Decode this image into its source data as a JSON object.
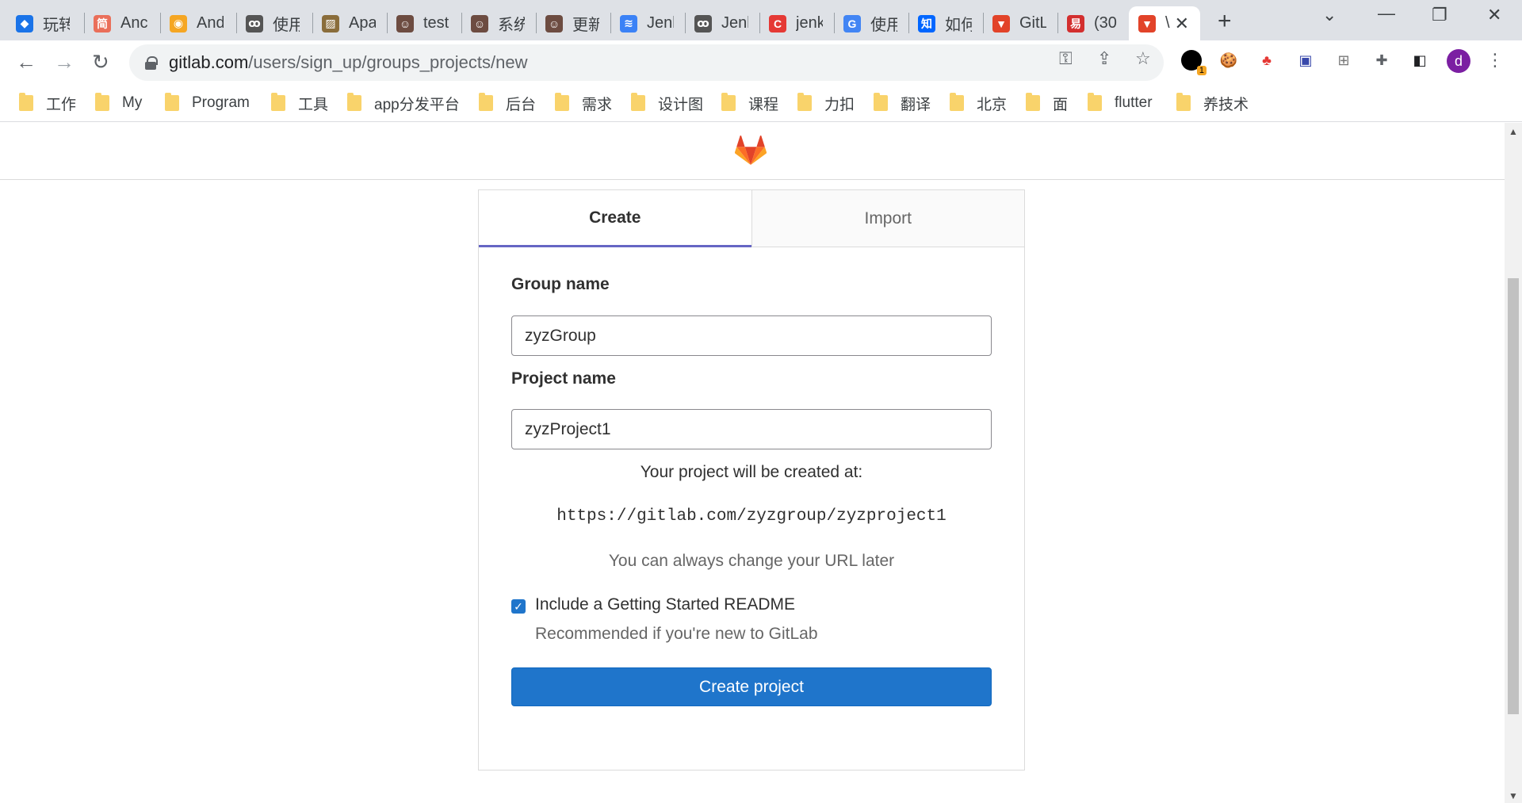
{
  "browser": {
    "tabs": [
      {
        "title": "玩转",
        "favicon_char": "◆",
        "favicon_color": "#1a73e8"
      },
      {
        "title": "Anc",
        "favicon_char": "简",
        "favicon_color": "#ea6f5a"
      },
      {
        "title": "And",
        "favicon_char": "◉",
        "favicon_color": "#f5a623"
      },
      {
        "title": "使用",
        "favicon_char": "ꝏ",
        "favicon_color": "#555555"
      },
      {
        "title": "Apa",
        "favicon_char": "▨",
        "favicon_color": "#8a6d3b"
      },
      {
        "title": "test",
        "favicon_char": "☺",
        "favicon_color": "#6d4c41"
      },
      {
        "title": "系统",
        "favicon_char": "☺",
        "favicon_color": "#6d4c41"
      },
      {
        "title": "更新",
        "favicon_char": "☺",
        "favicon_color": "#6d4c41"
      },
      {
        "title": "Jenk",
        "favicon_char": "≋",
        "favicon_color": "#3b82f6"
      },
      {
        "title": "Jenk",
        "favicon_char": "ꝏ",
        "favicon_color": "#555555"
      },
      {
        "title": "jenk",
        "favicon_char": "C",
        "favicon_color": "#e53935"
      },
      {
        "title": "使用",
        "favicon_char": "G",
        "favicon_color": "#4285f4"
      },
      {
        "title": "如何",
        "favicon_char": "知",
        "favicon_color": "#0066ff"
      },
      {
        "title": "GitL",
        "favicon_char": "▼",
        "favicon_color": "#e24329"
      },
      {
        "title": "(30",
        "favicon_char": "易",
        "favicon_color": "#d32f2f"
      },
      {
        "title": "\\",
        "favicon_char": "▼",
        "favicon_color": "#e24329"
      }
    ],
    "new_tab_label": "+",
    "address": {
      "domain": "gitlab.com",
      "path": "/users/sign_up/groups_projects/new"
    },
    "profile_initial": "d",
    "extension_badge": "1",
    "bookmarks": [
      "工作",
      "My",
      "Program",
      "工具",
      "app分发平台",
      "后台",
      "需求",
      "设计图",
      "课程",
      "力扣",
      "翻译",
      "北京",
      "面",
      "flutter",
      "养技术"
    ]
  },
  "page": {
    "tabs": {
      "create": "Create",
      "import": "Import"
    },
    "group_name": {
      "label": "Group name",
      "value": "zyzGroup"
    },
    "project_name": {
      "label": "Project name",
      "value": "zyzProject1"
    },
    "created_at_text": "Your project will be created at:",
    "project_url": "https://gitlab.com/zyzgroup/zyzproject1",
    "url_hint": "You can always change your URL later",
    "readme": {
      "checked": true,
      "label": "Include a Getting Started README",
      "help": "Recommended if you're new to GitLab"
    },
    "submit_label": "Create project"
  },
  "colors": {
    "primary_button": "#1f75cb",
    "active_tab_underline": "#6666c4",
    "gitlab_orange": "#e24329"
  }
}
